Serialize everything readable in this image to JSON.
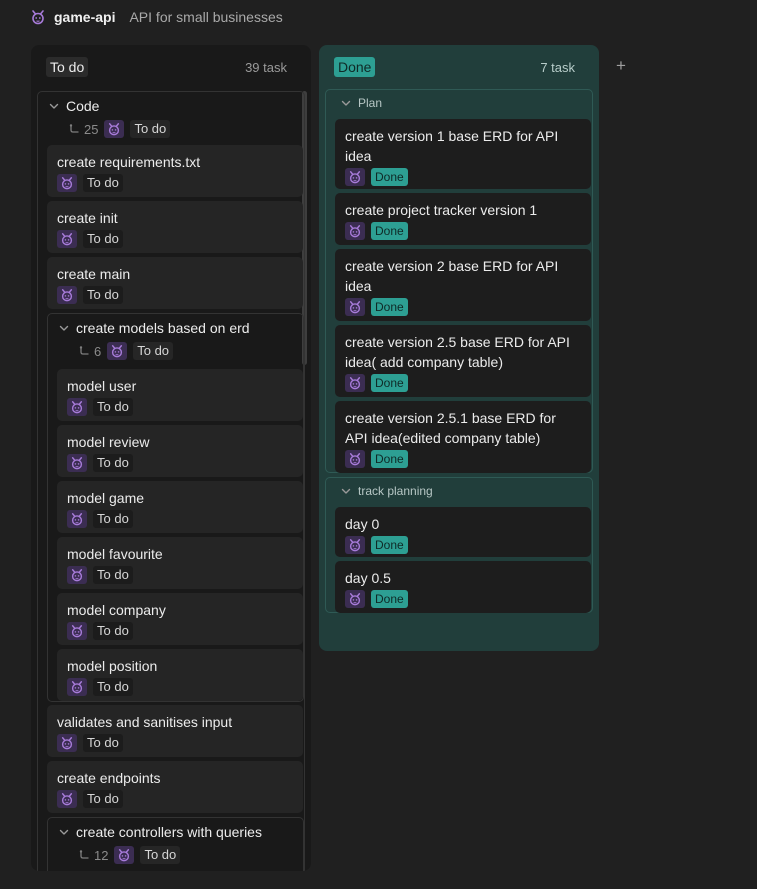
{
  "app": {
    "name": "game-api",
    "description": "API for small businesses"
  },
  "columns": {
    "todo": {
      "title": "To do",
      "count": "39 task"
    },
    "done": {
      "title": "Done",
      "count": "7 task"
    }
  },
  "add_column": "+",
  "todo_groups": {
    "code": {
      "title": "Code",
      "subtask_count": "25",
      "status": "To do"
    },
    "models": {
      "title": "create models based on erd",
      "subtask_count": "6",
      "status": "To do"
    },
    "controllers": {
      "title": "create controllers with queries",
      "subtask_count": "12",
      "status": "To do"
    }
  },
  "todo_cards": [
    {
      "title": "create requirements.txt",
      "status": "To do"
    },
    {
      "title": "create init",
      "status": "To do"
    },
    {
      "title": "create main",
      "status": "To do"
    },
    {
      "title": "validates and sanitises input",
      "status": "To do"
    },
    {
      "title": "create endpoints",
      "status": "To do"
    }
  ],
  "model_cards": [
    {
      "title": "model user",
      "status": "To do"
    },
    {
      "title": "model review",
      "status": "To do"
    },
    {
      "title": "model game",
      "status": "To do"
    },
    {
      "title": "model favourite",
      "status": "To do"
    },
    {
      "title": "model company",
      "status": "To do"
    },
    {
      "title": "model position",
      "status": "To do"
    }
  ],
  "done_groups": {
    "plan": {
      "title": "Plan"
    },
    "track": {
      "title": "track planning"
    }
  },
  "plan_cards": [
    {
      "title_line1": "create version 1 base ERD for API",
      "title_line2": "idea",
      "status": "Done"
    },
    {
      "title_line1": "create project tracker version 1",
      "status": "Done"
    },
    {
      "title_line1": "create version 2 base ERD for API",
      "title_line2": "idea",
      "status": "Done"
    },
    {
      "title_line1": "create version 2.5 base ERD for API",
      "title_line2": "idea( add company table)",
      "status": "Done"
    },
    {
      "title_line1": "create version 2.5.1 base ERD for",
      "title_line2": "API idea(edited company table)",
      "status": "Done"
    }
  ],
  "track_cards": [
    {
      "title": "day 0",
      "status": "Done"
    },
    {
      "title": "day 0.5",
      "status": "Done"
    }
  ],
  "colors": {
    "accent": "#2d9f93",
    "avatar": "#3b2d52",
    "avatar_face": "#a77bd9"
  }
}
